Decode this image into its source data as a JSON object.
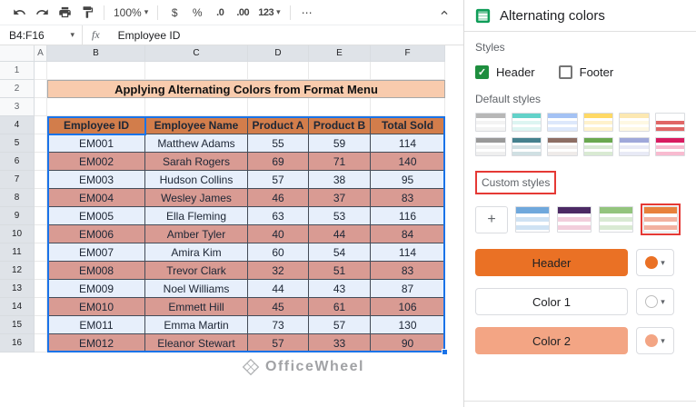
{
  "icons": {
    "caret_down": "▾",
    "more": "⋯",
    "check": "✓",
    "undo": "undo-arrow",
    "redo": "redo-arrow",
    "print": "printer",
    "paint_format": "paint-roller",
    "collapse": "chevron-up"
  },
  "toolbar": {
    "zoom": "100%",
    "currency": "$",
    "percent": "%",
    "decrease_decimal": ".0",
    "increase_decimal": ".00",
    "more_formats": "123"
  },
  "formula_bar": {
    "range": "B4:F16",
    "fx": "fx",
    "value": "Employee ID"
  },
  "grid": {
    "column_headers": [
      "A",
      "B",
      "C",
      "D",
      "E",
      "F"
    ],
    "rows_visible": 16,
    "title": "Applying Alternating Colors from Format Menu",
    "selection_range": "B4:F16",
    "table": {
      "headers": [
        "Employee ID",
        "Employee Name",
        "Product A",
        "Product B",
        "Total Sold"
      ],
      "rows": [
        [
          "EM001",
          "Matthew Adams",
          "55",
          "59",
          "114"
        ],
        [
          "EM002",
          "Sarah Rogers",
          "69",
          "71",
          "140"
        ],
        [
          "EM003",
          "Hudson Collins",
          "57",
          "38",
          "95"
        ],
        [
          "EM004",
          "Wesley James",
          "46",
          "37",
          "83"
        ],
        [
          "EM005",
          "Ella Fleming",
          "63",
          "53",
          "116"
        ],
        [
          "EM006",
          "Amber Tyler",
          "40",
          "44",
          "84"
        ],
        [
          "EM007",
          "Amira Kim",
          "60",
          "54",
          "114"
        ],
        [
          "EM008",
          "Trevor Clark",
          "32",
          "51",
          "83"
        ],
        [
          "EM009",
          "Noel Williams",
          "44",
          "43",
          "87"
        ],
        [
          "EM010",
          "Emmett Hill",
          "45",
          "61",
          "106"
        ],
        [
          "EM011",
          "Emma Martin",
          "73",
          "57",
          "130"
        ],
        [
          "EM012",
          "Eleanor Stewart",
          "57",
          "33",
          "90"
        ]
      ]
    },
    "colors": {
      "title_bg": "#F8CBAD",
      "header_bg": "#E8813C",
      "band_light": "#FFFFFF",
      "band_dark": "#F0A28C",
      "selection_border": "#1A73E8",
      "selection_tint": "rgba(23,101,216,0.10)"
    }
  },
  "watermark": {
    "text": "OfficeWheel"
  },
  "sidebar": {
    "title": "Alternating colors",
    "styles_label": "Styles",
    "header_checkbox": {
      "label": "Header",
      "checked": true
    },
    "footer_checkbox": {
      "label": "Footer",
      "checked": false
    },
    "default_styles_label": "Default styles",
    "default_styles": [
      {
        "h": "#B7B7B7",
        "s": "#F3F3F3"
      },
      {
        "h": "#63D2C9",
        "s": "#DDF5F2"
      },
      {
        "h": "#A4C2F4",
        "s": "#DDE8FB"
      },
      {
        "h": "#FFD966",
        "s": "#FFF2CC"
      },
      {
        "h": "#FCE8B2",
        "s": "#FEF8E3"
      },
      {
        "h": "#FFFFFF",
        "s": "#E06666"
      },
      {
        "h": "#999999",
        "s": "#EFEFEF"
      },
      {
        "h": "#45818E",
        "s": "#D0E0E3"
      },
      {
        "h": "#8D6E63",
        "s": "#EFEBE9"
      },
      {
        "h": "#6AA84F",
        "s": "#D9EAD3"
      },
      {
        "h": "#9FA8DA",
        "s": "#E8EAF6"
      },
      {
        "h": "#D81B60",
        "s": "#F8BBD0"
      }
    ],
    "custom_styles_label": "Custom styles",
    "add_label": "+",
    "custom_styles": [
      {
        "h": "#6FA8DC",
        "s": "#CFE2F3",
        "selected": false
      },
      {
        "h": "#4C2A64",
        "s": "#F2CEDC",
        "selected": false
      },
      {
        "h": "#93C47D",
        "s": "#D9EAD3",
        "selected": false
      },
      {
        "h": "#E8813C",
        "s": "#F2B1A0",
        "selected": true
      }
    ],
    "color_buttons": [
      {
        "label": "Header",
        "bg": "#EA7125",
        "swatch": "#EA7125",
        "bordered": false
      },
      {
        "label": "Color 1",
        "bg": "#FFFFFF",
        "swatch": "#FFFFFF",
        "bordered": true
      },
      {
        "label": "Color 2",
        "bg": "#F3A584",
        "swatch": "#F3A584",
        "bordered": false
      }
    ],
    "annotation_color": "#E53935",
    "checkbox_color": "#1E8E3E",
    "icon_color": "#0F9D58"
  }
}
